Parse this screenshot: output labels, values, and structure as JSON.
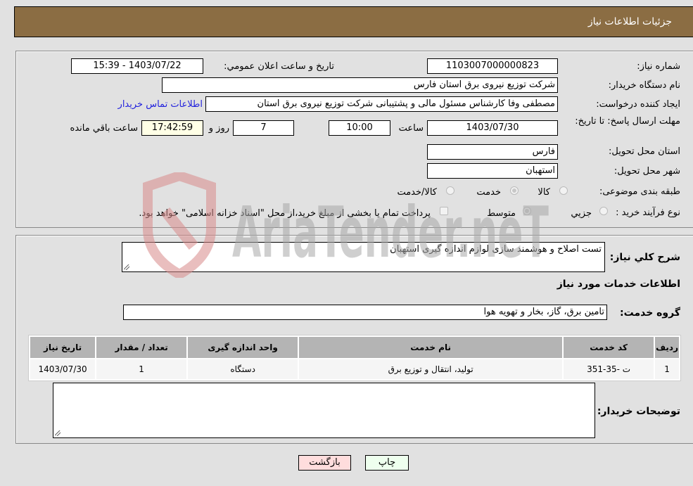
{
  "header": {
    "title": "جزئيات اطلاعات نياز"
  },
  "need_info": {
    "need_number_label": "شماره نیاز:",
    "need_number": "1103007000000823",
    "announce_label": "تاریخ و ساعت اعلان عمومي:",
    "announce_value": "1403/07/22 - 15:39",
    "buyer_org_label": "نام دستگاه خریدار:",
    "buyer_org": "شرکت توزیع نیروی برق استان فارس",
    "creator_label": "ایجاد کننده درخواست:",
    "creator": "مصطفی وفا کارشناس مسئول مالی و پشتیبانی شرکت توزیع نیروی برق استان",
    "contact_link": "اطلاعات تماس خریدار",
    "deadline_label": "مهلت ارسال پاسخ: تا تاریخ:",
    "deadline_date": "1403/07/30",
    "time_label": "ساعت",
    "deadline_time": "10:00",
    "days_value": "7",
    "days_label": "روز و",
    "remaining_time": "17:42:59",
    "remaining_label": "ساعت باقي مانده",
    "province_label": "استان محل تحویل:",
    "province": "فارس",
    "city_label": "شهر محل تحویل:",
    "city": "استهبان",
    "category_label": "طبقه بندی موضوعی:",
    "category_options": [
      {
        "label": "کالا",
        "checked": false
      },
      {
        "label": "خدمت",
        "checked": true
      },
      {
        "label": "کالا/خدمت",
        "checked": false
      }
    ],
    "process_label": "نوع فرآیند خرید :",
    "process_options": [
      {
        "label": "جزيي",
        "checked": false
      },
      {
        "label": "متوسط",
        "checked": true
      }
    ],
    "treasury_note": "پرداخت تمام یا بخشی از مبلغ خرید،از محل \"اسناد خزانه اسلامی\" خواهد بود."
  },
  "details": {
    "description_label": "شرح کلي نياز:",
    "description": "تست اصلاح و هوشمند سازی لوازم اندازه گیری استهبان",
    "services_heading": "اطلاعات خدمات مورد نياز",
    "service_group_label": "گروه خدمت:",
    "service_group": "تامین برق، گاز، بخار و تهویه هوا",
    "table": {
      "headers": [
        "ردیف",
        "کد خدمت",
        "نام خدمت",
        "واحد اندازه گیری",
        "تعداد / مقدار",
        "تاریخ نیاز"
      ],
      "rows": [
        [
          "1",
          "ت -35-351",
          "تولید، انتقال و توزیع برق",
          "دستگاه",
          "1",
          "1403/07/30"
        ]
      ]
    },
    "buyer_notes_label": "توضیحات خریدار:",
    "buyer_notes": ""
  },
  "buttons": {
    "print": "چاپ",
    "back": "بازگشت"
  },
  "watermark": {
    "text": "AriaTender.neT"
  },
  "colors": {
    "header_bg": "#8b6d43",
    "print_bg": "#eeffee",
    "back_bg": "#ffdddd",
    "link": "#2222dd"
  }
}
